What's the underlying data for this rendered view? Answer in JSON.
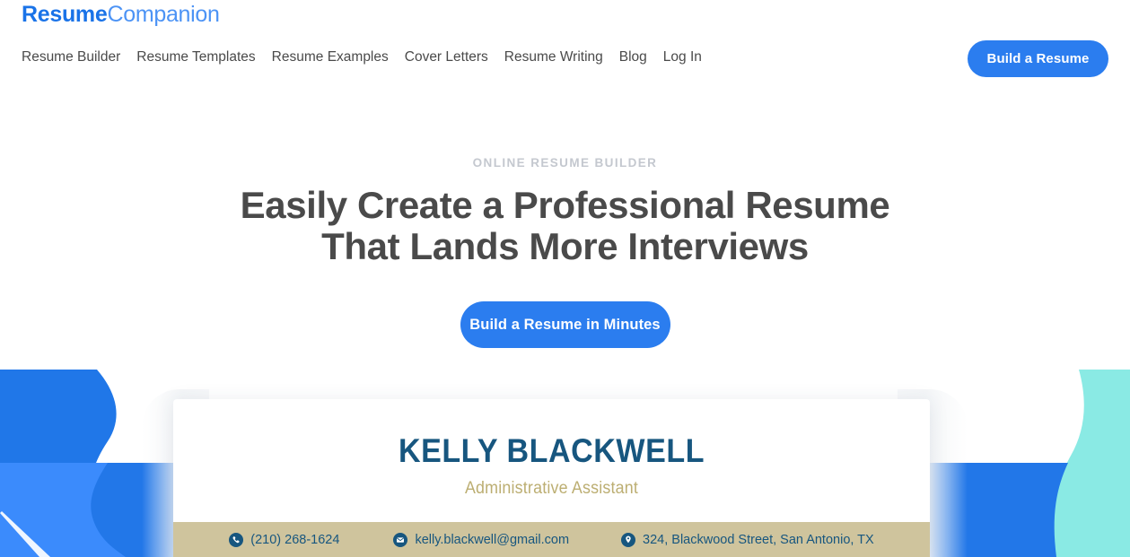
{
  "header": {
    "logo": {
      "strong": "Resume",
      "light": "Companion",
      "name": "ResumeCompanion"
    },
    "nav": [
      {
        "label": "Resume Builder",
        "name": "nav-resume-builder"
      },
      {
        "label": "Resume Templates",
        "name": "nav-resume-templates"
      },
      {
        "label": "Resume Examples",
        "name": "nav-resume-examples"
      },
      {
        "label": "Cover Letters",
        "name": "nav-cover-letters"
      },
      {
        "label": "Resume Writing",
        "name": "nav-resume-writing"
      },
      {
        "label": "Blog",
        "name": "nav-blog"
      },
      {
        "label": "Log In",
        "name": "nav-log-in"
      }
    ],
    "cta_label": "Build a Resume"
  },
  "hero": {
    "eyebrow": "ONLINE RESUME BUILDER",
    "title_line1": "Easily Create a Professional Resume",
    "title_line2": "That Lands More Interviews",
    "cta_label": "Build a Resume in Minutes"
  },
  "resume_preview": {
    "name": "KELLY BLACKWELL",
    "role": "Administrative Assistant",
    "contacts": [
      {
        "icon": "phone-icon",
        "value": "(210) 268-1624"
      },
      {
        "icon": "email-icon",
        "value": "kelly.blackwell@gmail.com"
      },
      {
        "icon": "location-icon",
        "value": "324, Blackwood Street, San Antonio, TX"
      }
    ]
  },
  "colors": {
    "brand_blue": "#2b7def",
    "logo_blue": "#1a73e8",
    "logo_light_blue": "#4c93f5",
    "band_blue": "#2277e8",
    "wave_blue_dark": "#2077e8",
    "wave_blue_light": "#3b8bfc",
    "teal": "#8aeae4",
    "resume_navy": "#17567f",
    "resume_gold": "#bcae72",
    "contact_bar_tan": "#cfc49d",
    "heading_gray": "#4a4a4a",
    "eyebrow_gray": "#c4c8cf"
  }
}
